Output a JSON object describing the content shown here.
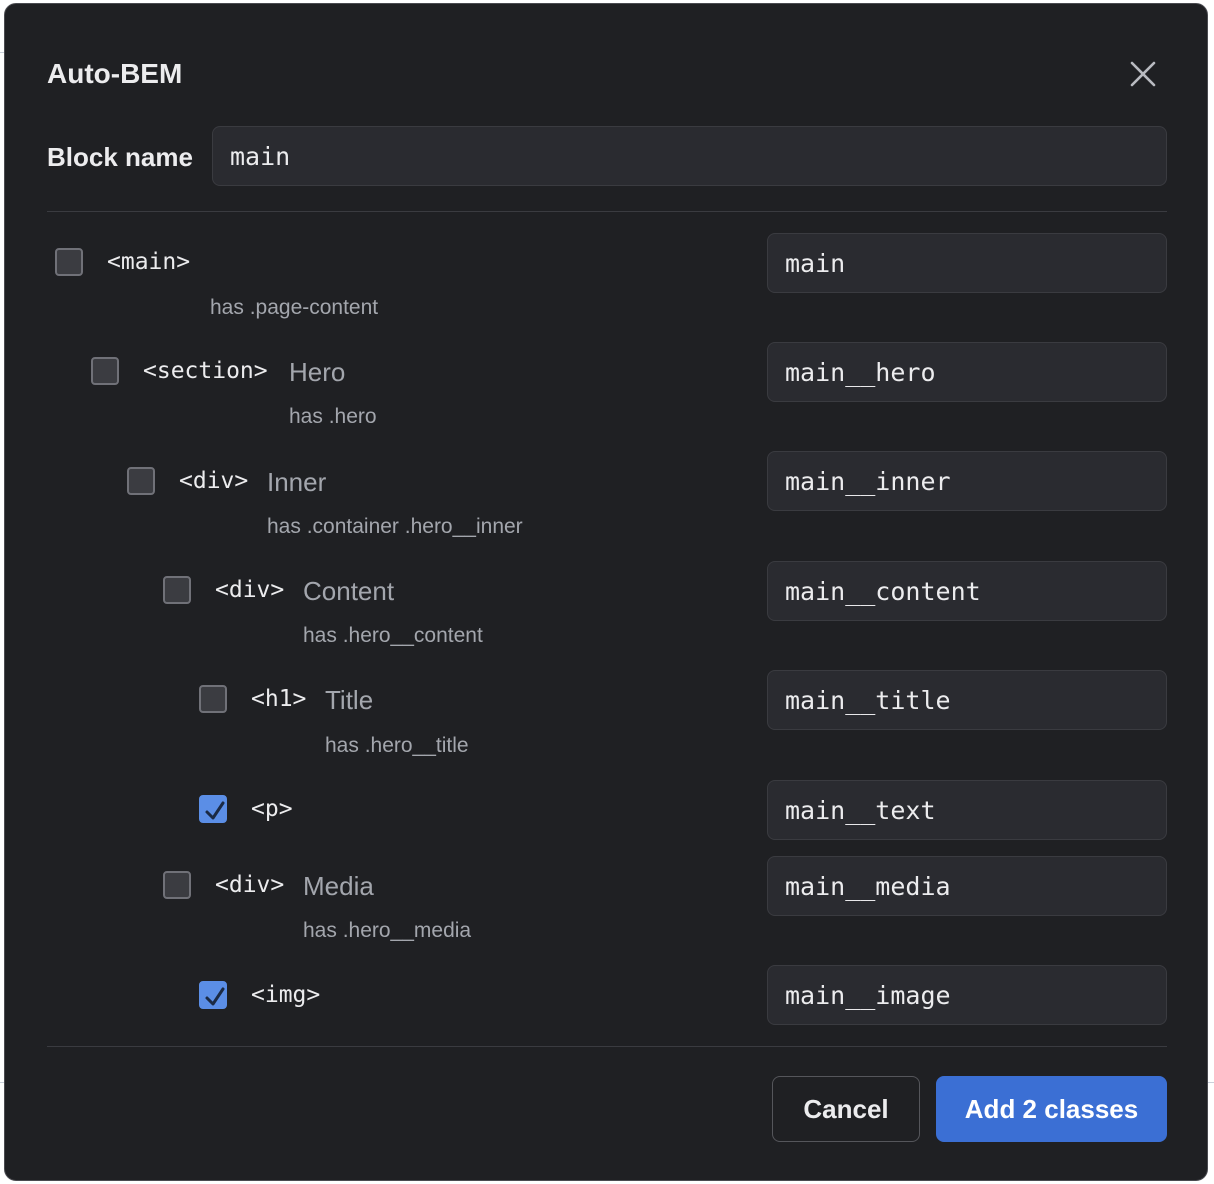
{
  "dialog": {
    "title": "Auto-BEM",
    "block_label": "Block name",
    "block_value": "main"
  },
  "rows": [
    {
      "tag": "<main>",
      "role": "",
      "has": "has .page-content",
      "checked": false,
      "class": "main"
    },
    {
      "tag": "<section>",
      "role": "Hero",
      "has": "has .hero",
      "checked": false,
      "class": "main__hero"
    },
    {
      "tag": "<div>",
      "role": "Inner",
      "has": "has .container .hero__inner",
      "checked": false,
      "class": "main__inner"
    },
    {
      "tag": "<div>",
      "role": "Content",
      "has": "has .hero__content",
      "checked": false,
      "class": "main__content"
    },
    {
      "tag": "<h1>",
      "role": "Title",
      "has": "has .hero__title",
      "checked": false,
      "class": "main__title"
    },
    {
      "tag": "<p>",
      "role": "",
      "has": "",
      "checked": true,
      "class": "main__text"
    },
    {
      "tag": "<div>",
      "role": "Media",
      "has": "has .hero__media",
      "checked": false,
      "class": "main__media"
    },
    {
      "tag": "<img>",
      "role": "",
      "has": "",
      "checked": true,
      "class": "main__image"
    }
  ],
  "footer": {
    "cancel_label": "Cancel",
    "primary_label": "Add 2 classes"
  },
  "colors": {
    "background": "#1f2023",
    "input": "#2a2b30",
    "accent": "#3b6fd4",
    "checkbox_checked": "#5b8ee6"
  },
  "icons": {
    "close": "close-icon",
    "check": "check-icon"
  }
}
